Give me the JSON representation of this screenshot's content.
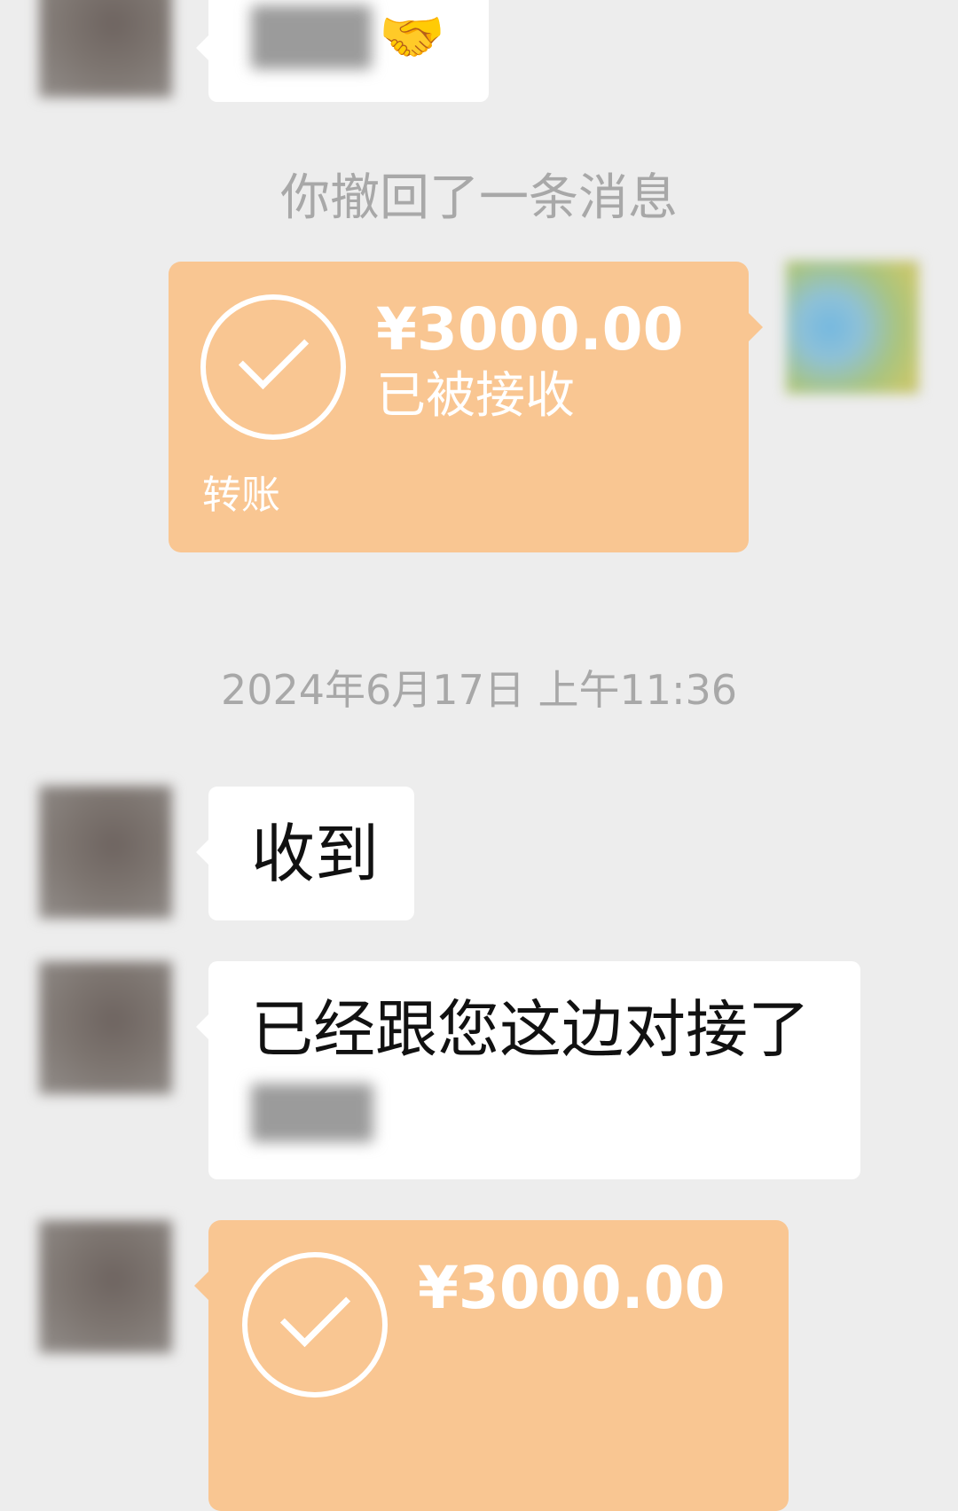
{
  "messages": {
    "first": {
      "emoji": "🤝"
    },
    "recall_notice": "你撤回了一条消息",
    "transfer_sent": {
      "amount": "¥3000.00",
      "status": "已被接收",
      "label": "转账"
    },
    "timestamp": "2024年6月17日 上午11:36",
    "reply_received": "收到",
    "reply_connected": "已经跟您这边对接了",
    "transfer_received": {
      "amount": "¥3000.00"
    }
  },
  "colors": {
    "background": "#ededed",
    "bubble": "#ffffff",
    "transfer_card": "#f9c692",
    "system_text": "#a8a8a8"
  }
}
